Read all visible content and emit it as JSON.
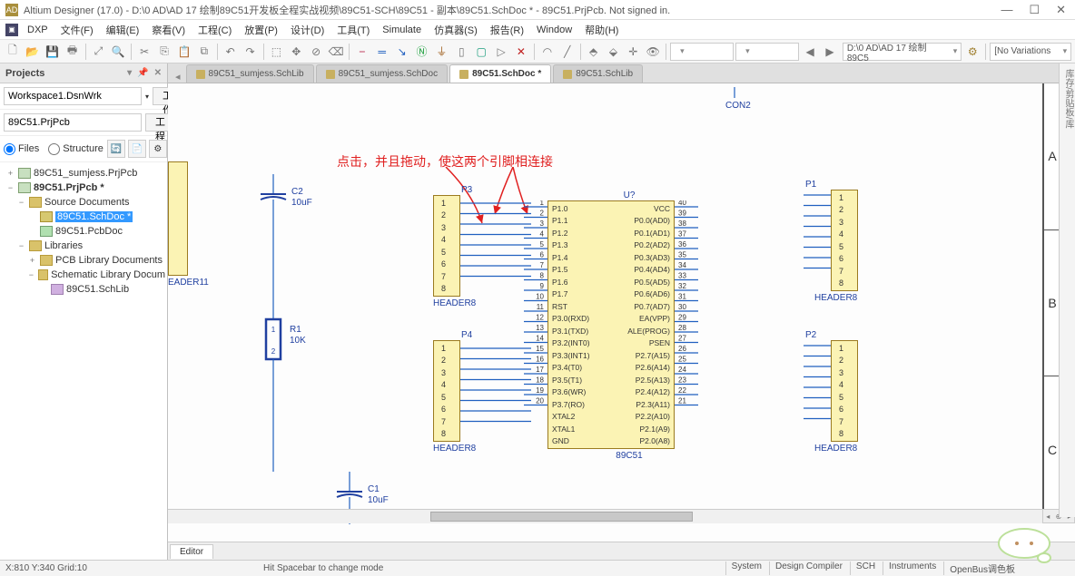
{
  "app": {
    "title": "Altium Designer (17.0) - D:\\0 AD\\AD 17 绘制89C51开发板全程实战视频\\89C51-SCH\\89C51 - 副本\\89C51.SchDoc * - 89C51.PrjPcb. Not signed in.",
    "logo_alt": "AD"
  },
  "menu": {
    "dxp": "DXP",
    "items": [
      "文件(F)",
      "编辑(E)",
      "察看(V)",
      "工程(C)",
      "放置(P)",
      "设计(D)",
      "工具(T)",
      "Simulate",
      "仿真器(S)",
      "报告(R)",
      "Window",
      "帮助(H)"
    ]
  },
  "toolbar": {
    "path_combo": "D:\\0 AD\\AD 17 绘制89C5",
    "variations": "[No Variations"
  },
  "projects": {
    "header": "Projects",
    "workspace": "Workspace1.DsnWrk",
    "btn_workbench": "工作台",
    "project": "89C51.PrjPcb",
    "btn_project": "工程",
    "radio_files": "Files",
    "radio_structure": "Structure",
    "tree": [
      {
        "level": 0,
        "icon": "proj",
        "expand": "+",
        "label": "89C51_sumjess.PrjPcb"
      },
      {
        "level": 0,
        "icon": "proj",
        "expand": "−",
        "label": "89C51.PrjPcb *",
        "bold": true
      },
      {
        "level": 1,
        "icon": "folder",
        "expand": "−",
        "label": "Source Documents"
      },
      {
        "level": 2,
        "icon": "sch",
        "expand": "",
        "label": "89C51.SchDoc *",
        "selected": true
      },
      {
        "level": 2,
        "icon": "pcb",
        "expand": "",
        "label": "89C51.PcbDoc"
      },
      {
        "level": 1,
        "icon": "folder",
        "expand": "−",
        "label": "Libraries"
      },
      {
        "level": 2,
        "icon": "folder",
        "expand": "+",
        "label": "PCB Library Documents"
      },
      {
        "level": 2,
        "icon": "folder",
        "expand": "−",
        "label": "Schematic Library Docum"
      },
      {
        "level": 3,
        "icon": "lib",
        "expand": "",
        "label": "89C51.SchLib"
      }
    ]
  },
  "doctabs": [
    {
      "label": "89C51_sumjess.SchLib",
      "active": false
    },
    {
      "label": "89C51_sumjess.SchDoc",
      "active": false
    },
    {
      "label": "89C51.SchDoc *",
      "active": true
    },
    {
      "label": "89C51.SchLib",
      "active": false
    }
  ],
  "sheet_zones": [
    "A",
    "B",
    "C"
  ],
  "annotation": "点击，并且拖动，使这两个引脚相连接",
  "components": {
    "con2": {
      "label": "CON2"
    },
    "header11": {
      "label": "EADER11"
    },
    "c2": {
      "ref": "C2",
      "val": "10uF"
    },
    "c1": {
      "ref": "C1",
      "val": "10uF"
    },
    "r1": {
      "ref": "R1",
      "val": "10K"
    },
    "p1": {
      "ref": "P1",
      "foot": "HEADER8",
      "pins": [
        "1",
        "2",
        "3",
        "4",
        "5",
        "6",
        "7",
        "8"
      ]
    },
    "p2": {
      "ref": "P2",
      "foot": "HEADER8",
      "pins": [
        "1",
        "2",
        "3",
        "4",
        "5",
        "6",
        "7",
        "8"
      ]
    },
    "p3": {
      "ref": "P3",
      "foot": "HEADER8",
      "pins": [
        "1",
        "2",
        "3",
        "4",
        "5",
        "6",
        "7",
        "8"
      ]
    },
    "p4": {
      "ref": "P4",
      "foot": "HEADER8",
      "pins": [
        "1",
        "2",
        "3",
        "4",
        "5",
        "6",
        "7",
        "8"
      ]
    },
    "u": {
      "ref": "U?",
      "foot": "89C51",
      "left_nums": [
        "1",
        "2",
        "3",
        "4",
        "5",
        "6",
        "7",
        "8",
        "9",
        "10",
        "11",
        "12",
        "13",
        "14",
        "15",
        "16",
        "17",
        "18",
        "19",
        "20"
      ],
      "left_names": [
        "P1.0",
        "P1.1",
        "P1.2",
        "P1.3",
        "P1.4",
        "P1.5",
        "P1.6",
        "P1.7",
        "RST",
        "P3.0(RXD)",
        "P3.1(TXD)",
        "P3.2(INT0)",
        "P3.3(INT1)",
        "P3.4(T0)",
        "P3.5(T1)",
        "P3.6(WR)",
        "P3.7(RO)",
        "XTAL2",
        "XTAL1",
        "GND"
      ],
      "right_nums": [
        "40",
        "39",
        "38",
        "37",
        "36",
        "35",
        "34",
        "33",
        "32",
        "31",
        "30",
        "29",
        "28",
        "27",
        "26",
        "25",
        "24",
        "23",
        "22",
        "21"
      ],
      "right_names": [
        "VCC",
        "P0.0(AD0)",
        "P0.1(AD1)",
        "P0.2(AD2)",
        "P0.3(AD3)",
        "P0.4(AD4)",
        "P0.5(AD5)",
        "P0.6(AD6)",
        "P0.7(AD7)",
        "EA(VPP)",
        "ALE(PROG)",
        "PSEN",
        "P2.7(A15)",
        "P2.6(A14)",
        "P2.5(A13)",
        "P2.4(A12)",
        "P2.3(A11)",
        "P2.2(A10)",
        "P2.1(A9)",
        "P2.0(A8)"
      ]
    }
  },
  "bottom_tab": "Editor",
  "status": {
    "coords": "X:810 Y:340  Grid:10",
    "hint": "Hit Spacebar to change mode",
    "panels": [
      "System",
      "Design Compiler",
      "SCH",
      "Instruments",
      "OpenBus调色板"
    ]
  },
  "side_tabs": "库存/剪贴板/库"
}
